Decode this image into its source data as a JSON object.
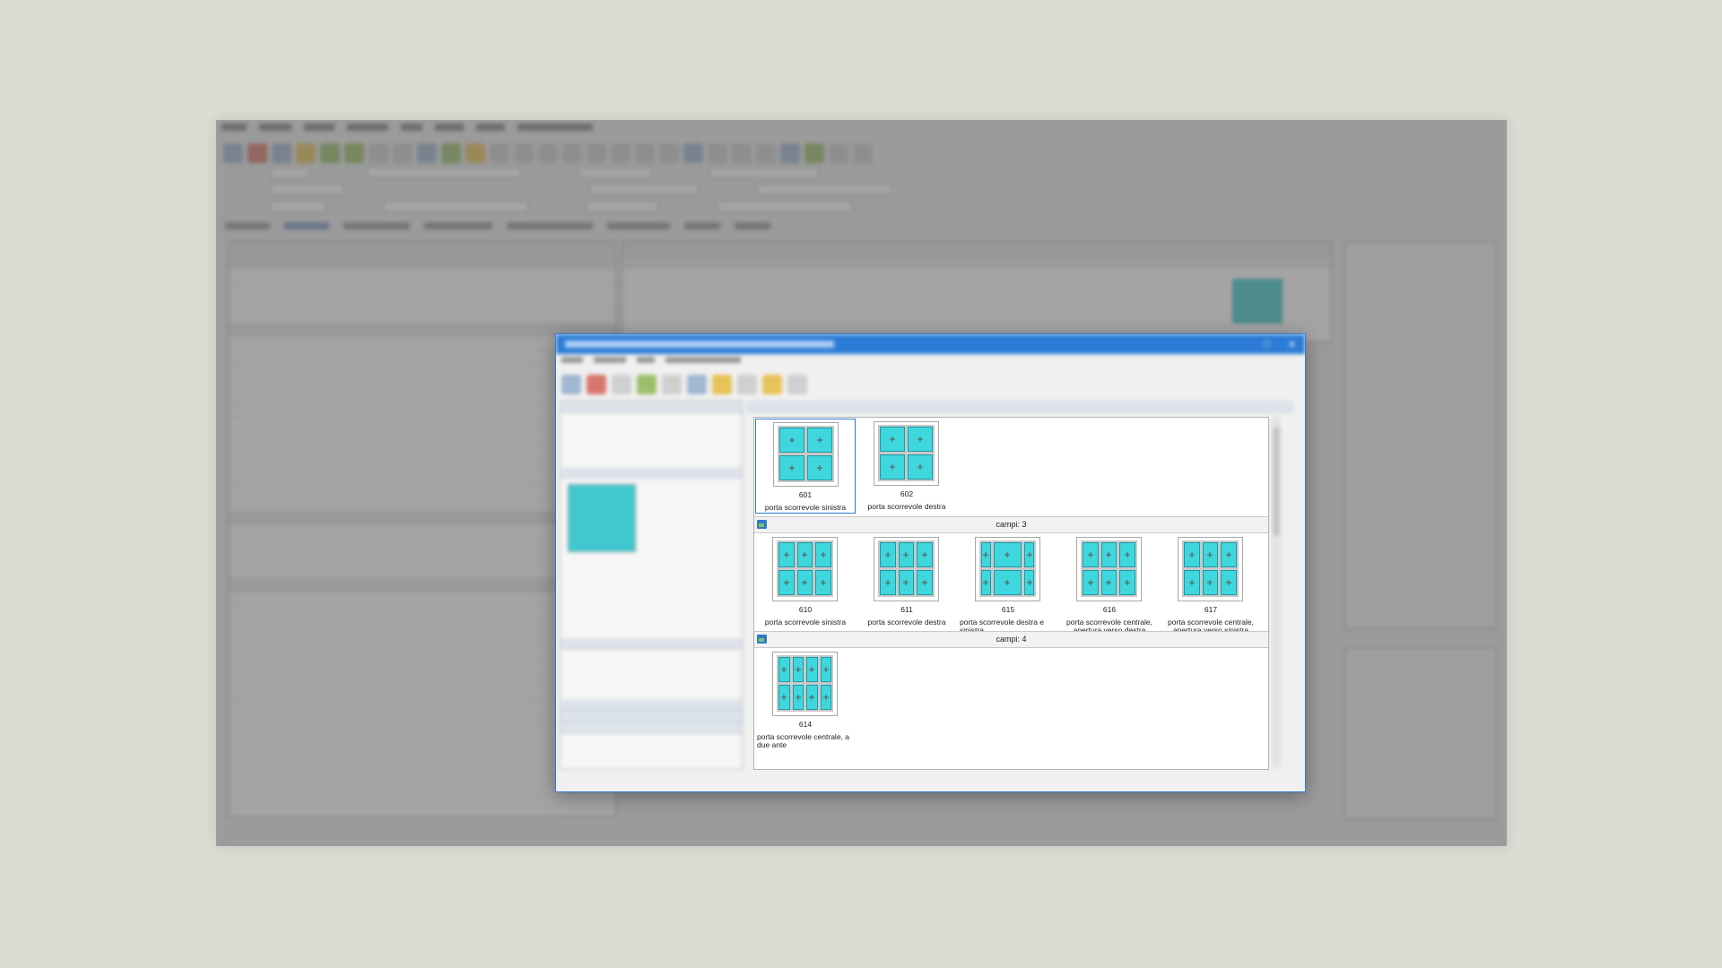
{
  "gallery": {
    "groups": [
      {
        "header": "",
        "items": [
          {
            "number": "601",
            "caption": "porta scorrevole sinistra",
            "selected": true,
            "layout": "2x2"
          },
          {
            "number": "602",
            "caption": "porta scorrevole destra",
            "selected": false,
            "layout": "2x2"
          }
        ]
      },
      {
        "header": "campi: 3",
        "items": [
          {
            "number": "610",
            "caption": "porta scorrevole sinistra",
            "selected": false,
            "layout": "3x2"
          },
          {
            "number": "611",
            "caption": "porta scorrevole destra",
            "selected": false,
            "layout": "3x2"
          },
          {
            "number": "615",
            "caption": "porta scorrevole destra e sinistra",
            "selected": false,
            "layout": "wide"
          },
          {
            "number": "616",
            "caption": "porta scorrevole centrale, apertura verso destra",
            "selected": false,
            "layout": "3x2"
          },
          {
            "number": "617",
            "caption": "porta scorrevole centrale, apertura verso sinistra",
            "selected": false,
            "layout": "3x2"
          }
        ]
      },
      {
        "header": "campi: 4",
        "items": [
          {
            "number": "614",
            "caption": "porta scorrevole centrale, a due ante",
            "selected": false,
            "layout": "4x2"
          }
        ]
      }
    ]
  },
  "colors": {
    "glass": "#3fd7de",
    "selection": "#2c7bd6",
    "dialog_title_bar": "#2c7bd6"
  }
}
